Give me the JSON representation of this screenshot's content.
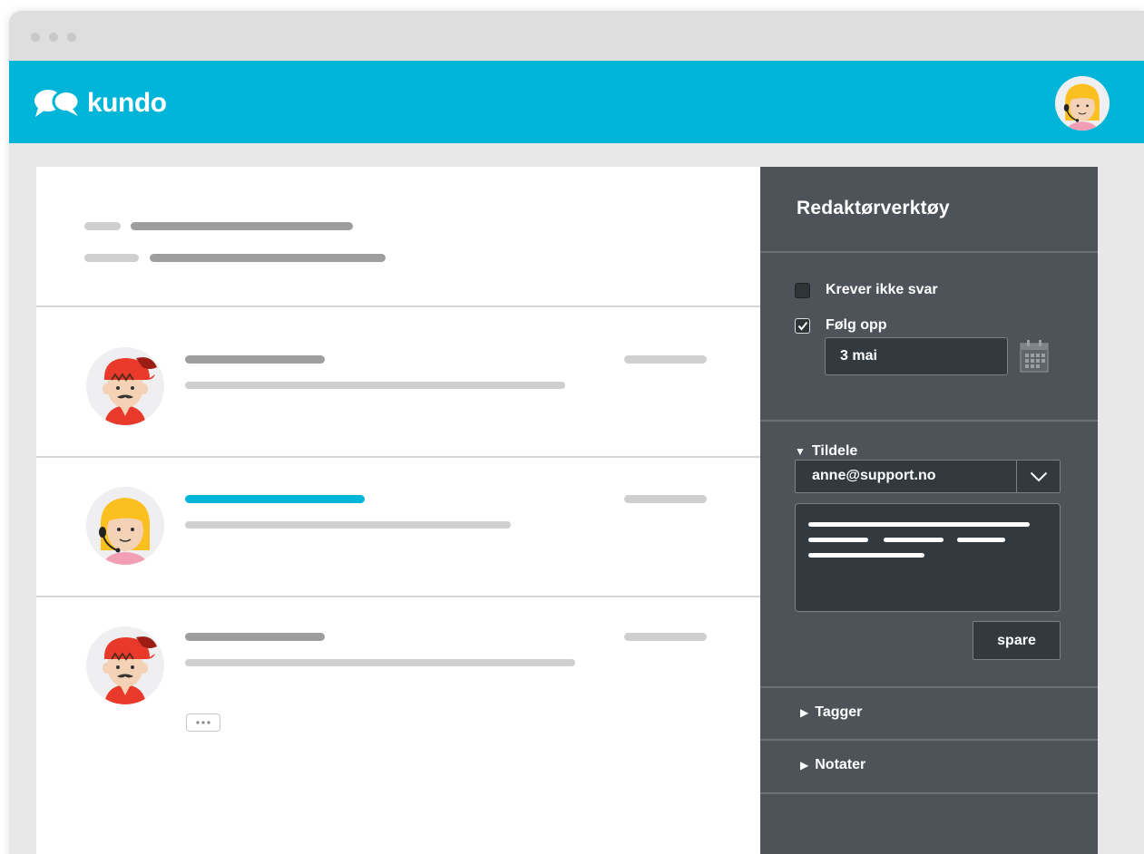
{
  "brand": {
    "name": "kundo",
    "color": "#00b5d8"
  },
  "panel": {
    "title": "Redaktørverktøy",
    "checkboxes": [
      {
        "label": "Krever ikke svar",
        "checked": false
      },
      {
        "label": "Følg opp",
        "checked": true
      }
    ],
    "date_value": "3 mai",
    "assign": {
      "heading": "Tildele",
      "selected": "anne@support.no"
    },
    "save_label": "spare",
    "collapsed_sections": [
      {
        "heading": "Tagger"
      },
      {
        "heading": "Notater"
      }
    ]
  },
  "icons": {
    "logo": "speech-bubbles-icon",
    "calendar": "calendar-icon",
    "dropdown": "chevron-down-icon",
    "expanded": "triangle-down-icon",
    "collapsed": "triangle-right-icon",
    "more": "ellipsis-icon"
  },
  "colors": {
    "accent": "#00b5d8",
    "panel_bg": "#4d5359",
    "input_bg": "#323a40",
    "placeholder_bar": "#9e9e9e",
    "highlight_bar": "#00b5d8"
  }
}
